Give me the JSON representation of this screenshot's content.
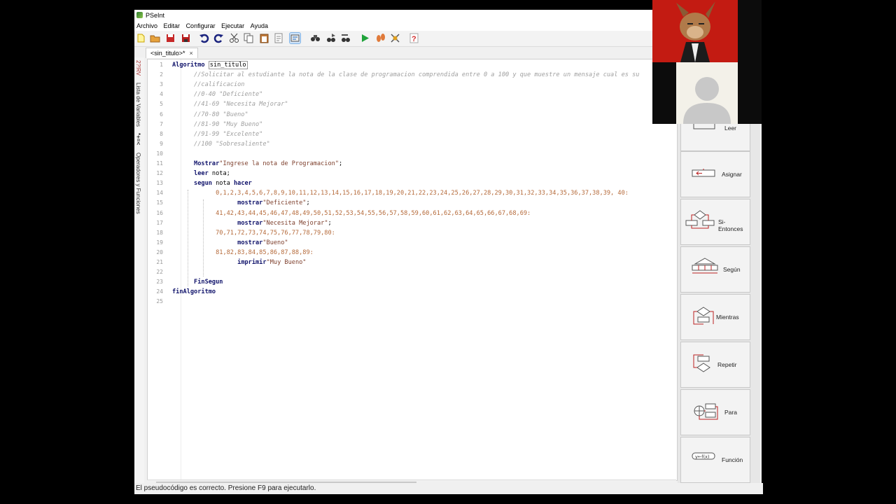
{
  "window": {
    "title": "PSeInt"
  },
  "menu": [
    "Archivo",
    "Editar",
    "Configurar",
    "Ejecutar",
    "Ayuda"
  ],
  "toolbar": {
    "icons": [
      "new-file-icon",
      "open-folder-icon",
      "save-icon",
      "save-as-icon",
      "undo-icon",
      "redo-icon",
      "cut-icon",
      "copy-icon",
      "paste-icon",
      "edit-icon",
      "indent-icon",
      "find-icon",
      "find-next-icon",
      "replace-icon",
      "run-icon",
      "step-icon",
      "debug-icon",
      "help-icon"
    ]
  },
  "tab": {
    "label": "<sin_titulo>*",
    "close": "×"
  },
  "side_panel": {
    "symbols": "2?!RV",
    "variables_label": "Lista de Variables",
    "operators_symbols": "*+=<",
    "operators_label": "Operadores y Funciones"
  },
  "editor": {
    "lines": [
      {
        "n": "1",
        "html": "<span class='kw'>Algoritmo</span> <span class='hbox'>sin_titulo</span>"
      },
      {
        "n": "2",
        "html": "   <span class='cm'>//Solicitar al estudiante la nota de la clase de programacion comprendida entre 0 a 100 y que muestre un mensaje cual es su</span>"
      },
      {
        "n": "3",
        "html": "   <span class='cm'>//calificacion</span>"
      },
      {
        "n": "4",
        "html": "   <span class='cm'>//0-40 \"Deficiente\"</span>"
      },
      {
        "n": "5",
        "html": "   <span class='cm'>//41-69 \"Necesita Mejorar\"</span>"
      },
      {
        "n": "6",
        "html": "   <span class='cm'>//70-80 \"Bueno\"</span>"
      },
      {
        "n": "7",
        "html": "   <span class='cm'>//81-90 \"Muy Bueno\"</span>"
      },
      {
        "n": "8",
        "html": "   <span class='cm'>//91-99 \"Excelente\"</span>"
      },
      {
        "n": "9",
        "html": "   <span class='cm'>//100 \"Sobresaliente\"</span>"
      },
      {
        "n": "10",
        "html": ""
      },
      {
        "n": "11",
        "html": "   <span class='kw'>Mostrar</span><span class='st'>\"Ingrese la nota de Programacion\"</span>;"
      },
      {
        "n": "12",
        "html": "   <span class='kw'>leer</span> nota;"
      },
      {
        "n": "13",
        "html": "   <span class='kw'>segun</span> nota <span class='kw'>hacer</span>"
      },
      {
        "n": "14",
        "html": "      <span class='nm'>0,1,2,3,4,5,6,7,8,9,10,11,12,13,14,15,16,17,18,19,20,21,22,23,24,25,26,27,28,29,30,31,32,33,34,35,36,37,38,39, 40:</span>"
      },
      {
        "n": "15",
        "html": "         <span class='kw'>mostrar</span><span class='st'>\"Deficiente\"</span>;"
      },
      {
        "n": "16",
        "html": "      <span class='nm'>41,42,43,44,45,46,47,48,49,50,51,52,53,54,55,56,57,58,59,60,61,62,63,64,65,66,67,68,69:</span>"
      },
      {
        "n": "17",
        "html": "         <span class='kw'>mostrar</span><span class='st'>\"Necesita Mejorar\"</span>;"
      },
      {
        "n": "18",
        "html": "      <span class='nm'>70,71,72,73,74,75,76,77,78,79,80:</span>"
      },
      {
        "n": "19",
        "html": "         <span class='kw'>mostrar</span><span class='st'>\"Bueno\"</span>"
      },
      {
        "n": "20",
        "html": "      <span class='nm'>81,82,83,84,85,86,87,88,89:</span>"
      },
      {
        "n": "21",
        "html": "         <span class='kw'>imprimir</span><span class='st'>\"Muy Bueno\"</span>"
      },
      {
        "n": "22",
        "html": ""
      },
      {
        "n": "23",
        "html": "   <span class='kw'>FinSegun</span>"
      },
      {
        "n": "24",
        "html": "<span class='kw'>finAlgoritmo</span>"
      },
      {
        "n": "25",
        "html": ""
      }
    ]
  },
  "status": "El pseudocódigo es correcto. Presione F9 para ejecutarlo.",
  "commands": [
    {
      "label": "Leer",
      "icon": "read-icon"
    },
    {
      "label": "Asignar",
      "icon": "assign-icon"
    },
    {
      "label": "Si-Entonces",
      "icon": "if-then-icon"
    },
    {
      "label": "Según",
      "icon": "switch-icon"
    },
    {
      "label": "Mientras",
      "icon": "while-icon"
    },
    {
      "label": "Repetir",
      "icon": "repeat-icon"
    },
    {
      "label": "Para",
      "icon": "for-icon"
    },
    {
      "label": "Función",
      "icon": "function-icon"
    }
  ]
}
